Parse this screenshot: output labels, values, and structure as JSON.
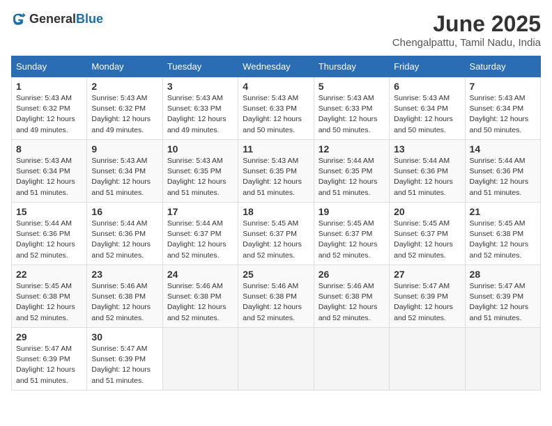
{
  "header": {
    "logo_general": "General",
    "logo_blue": "Blue",
    "title": "June 2025",
    "subtitle": "Chengalpattu, Tamil Nadu, India"
  },
  "calendar": {
    "days_of_week": [
      "Sunday",
      "Monday",
      "Tuesday",
      "Wednesday",
      "Thursday",
      "Friday",
      "Saturday"
    ],
    "weeks": [
      [
        {
          "day": "",
          "empty": true
        },
        {
          "day": "2",
          "sunrise": "Sunrise: 5:43 AM",
          "sunset": "Sunset: 6:32 PM",
          "daylight": "Daylight: 12 hours and 49 minutes."
        },
        {
          "day": "3",
          "sunrise": "Sunrise: 5:43 AM",
          "sunset": "Sunset: 6:33 PM",
          "daylight": "Daylight: 12 hours and 49 minutes."
        },
        {
          "day": "4",
          "sunrise": "Sunrise: 5:43 AM",
          "sunset": "Sunset: 6:33 PM",
          "daylight": "Daylight: 12 hours and 50 minutes."
        },
        {
          "day": "5",
          "sunrise": "Sunrise: 5:43 AM",
          "sunset": "Sunset: 6:33 PM",
          "daylight": "Daylight: 12 hours and 50 minutes."
        },
        {
          "day": "6",
          "sunrise": "Sunrise: 5:43 AM",
          "sunset": "Sunset: 6:34 PM",
          "daylight": "Daylight: 12 hours and 50 minutes."
        },
        {
          "day": "7",
          "sunrise": "Sunrise: 5:43 AM",
          "sunset": "Sunset: 6:34 PM",
          "daylight": "Daylight: 12 hours and 50 minutes."
        }
      ],
      [
        {
          "day": "1",
          "sunrise": "Sunrise: 5:43 AM",
          "sunset": "Sunset: 6:32 PM",
          "daylight": "Daylight: 12 hours and 49 minutes.",
          "first_in_week_col0": true
        },
        {
          "day": "8",
          "sunrise": "Sunrise: 5:43 AM",
          "sunset": "Sunset: 6:34 PM",
          "daylight": "Daylight: 12 hours and 51 minutes."
        },
        {
          "day": "9",
          "sunrise": "Sunrise: 5:43 AM",
          "sunset": "Sunset: 6:34 PM",
          "daylight": "Daylight: 12 hours and 51 minutes."
        },
        {
          "day": "10",
          "sunrise": "Sunrise: 5:43 AM",
          "sunset": "Sunset: 6:35 PM",
          "daylight": "Daylight: 12 hours and 51 minutes."
        },
        {
          "day": "11",
          "sunrise": "Sunrise: 5:43 AM",
          "sunset": "Sunset: 6:35 PM",
          "daylight": "Daylight: 12 hours and 51 minutes."
        },
        {
          "day": "12",
          "sunrise": "Sunrise: 5:44 AM",
          "sunset": "Sunset: 6:35 PM",
          "daylight": "Daylight: 12 hours and 51 minutes."
        },
        {
          "day": "13",
          "sunrise": "Sunrise: 5:44 AM",
          "sunset": "Sunset: 6:36 PM",
          "daylight": "Daylight: 12 hours and 51 minutes."
        },
        {
          "day": "14",
          "sunrise": "Sunrise: 5:44 AM",
          "sunset": "Sunset: 6:36 PM",
          "daylight": "Daylight: 12 hours and 51 minutes."
        }
      ],
      [
        {
          "day": "15",
          "sunrise": "Sunrise: 5:44 AM",
          "sunset": "Sunset: 6:36 PM",
          "daylight": "Daylight: 12 hours and 52 minutes."
        },
        {
          "day": "16",
          "sunrise": "Sunrise: 5:44 AM",
          "sunset": "Sunset: 6:36 PM",
          "daylight": "Daylight: 12 hours and 52 minutes."
        },
        {
          "day": "17",
          "sunrise": "Sunrise: 5:44 AM",
          "sunset": "Sunset: 6:37 PM",
          "daylight": "Daylight: 12 hours and 52 minutes."
        },
        {
          "day": "18",
          "sunrise": "Sunrise: 5:45 AM",
          "sunset": "Sunset: 6:37 PM",
          "daylight": "Daylight: 12 hours and 52 minutes."
        },
        {
          "day": "19",
          "sunrise": "Sunrise: 5:45 AM",
          "sunset": "Sunset: 6:37 PM",
          "daylight": "Daylight: 12 hours and 52 minutes."
        },
        {
          "day": "20",
          "sunrise": "Sunrise: 5:45 AM",
          "sunset": "Sunset: 6:37 PM",
          "daylight": "Daylight: 12 hours and 52 minutes."
        },
        {
          "day": "21",
          "sunrise": "Sunrise: 5:45 AM",
          "sunset": "Sunset: 6:38 PM",
          "daylight": "Daylight: 12 hours and 52 minutes."
        }
      ],
      [
        {
          "day": "22",
          "sunrise": "Sunrise: 5:45 AM",
          "sunset": "Sunset: 6:38 PM",
          "daylight": "Daylight: 12 hours and 52 minutes."
        },
        {
          "day": "23",
          "sunrise": "Sunrise: 5:46 AM",
          "sunset": "Sunset: 6:38 PM",
          "daylight": "Daylight: 12 hours and 52 minutes."
        },
        {
          "day": "24",
          "sunrise": "Sunrise: 5:46 AM",
          "sunset": "Sunset: 6:38 PM",
          "daylight": "Daylight: 12 hours and 52 minutes."
        },
        {
          "day": "25",
          "sunrise": "Sunrise: 5:46 AM",
          "sunset": "Sunset: 6:38 PM",
          "daylight": "Daylight: 12 hours and 52 minutes."
        },
        {
          "day": "26",
          "sunrise": "Sunrise: 5:46 AM",
          "sunset": "Sunset: 6:38 PM",
          "daylight": "Daylight: 12 hours and 52 minutes."
        },
        {
          "day": "27",
          "sunrise": "Sunrise: 5:47 AM",
          "sunset": "Sunset: 6:39 PM",
          "daylight": "Daylight: 12 hours and 52 minutes."
        },
        {
          "day": "28",
          "sunrise": "Sunrise: 5:47 AM",
          "sunset": "Sunset: 6:39 PM",
          "daylight": "Daylight: 12 hours and 51 minutes."
        }
      ],
      [
        {
          "day": "29",
          "sunrise": "Sunrise: 5:47 AM",
          "sunset": "Sunset: 6:39 PM",
          "daylight": "Daylight: 12 hours and 51 minutes."
        },
        {
          "day": "30",
          "sunrise": "Sunrise: 5:47 AM",
          "sunset": "Sunset: 6:39 PM",
          "daylight": "Daylight: 12 hours and 51 minutes."
        },
        {
          "day": "",
          "empty": true
        },
        {
          "day": "",
          "empty": true
        },
        {
          "day": "",
          "empty": true
        },
        {
          "day": "",
          "empty": true
        },
        {
          "day": "",
          "empty": true
        }
      ]
    ]
  }
}
